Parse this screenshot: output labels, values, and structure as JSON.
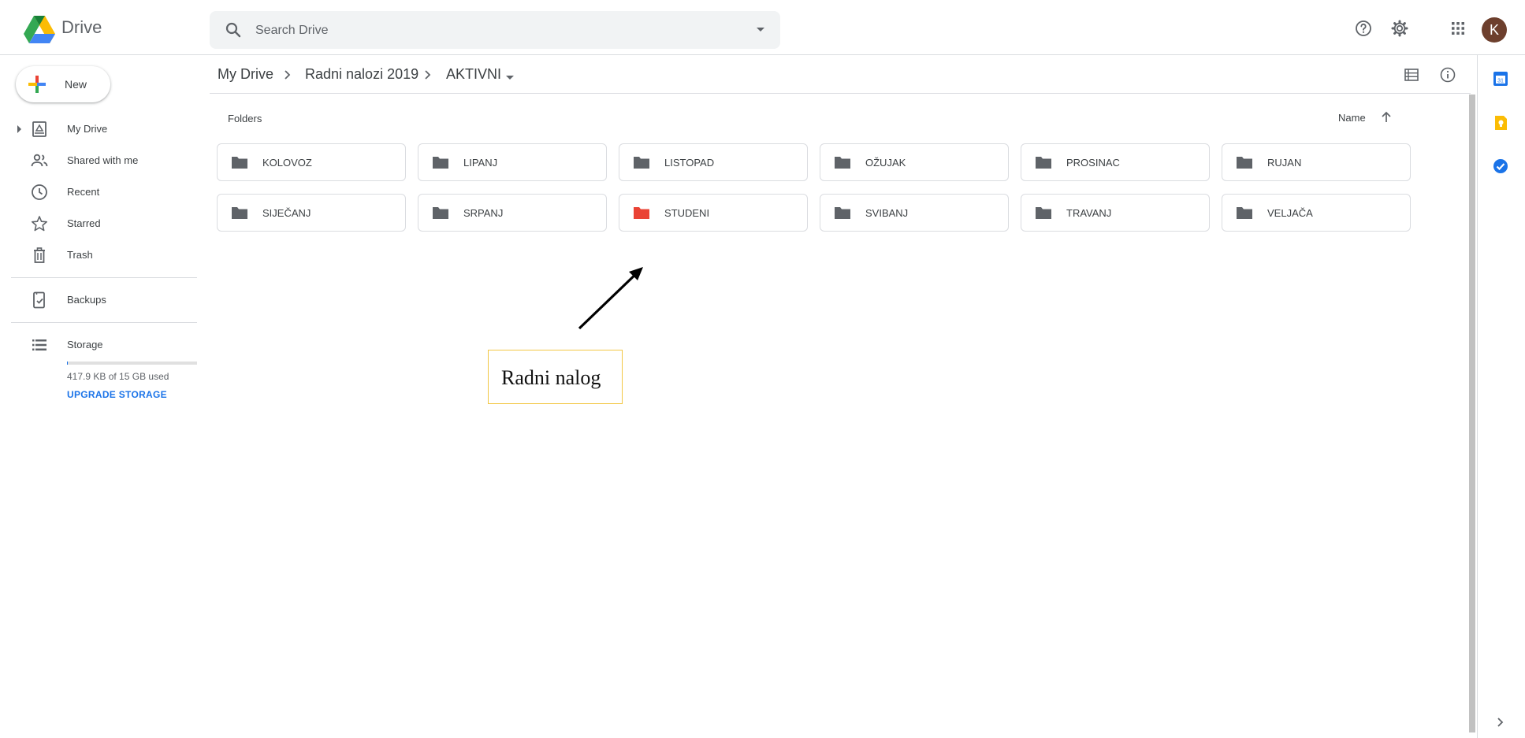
{
  "app": {
    "brand": "Drive",
    "avatar_initial": "K"
  },
  "search": {
    "placeholder": "Search Drive"
  },
  "sidebar": {
    "new_label": "New",
    "items": [
      {
        "label": "My Drive",
        "icon": "my-drive-icon"
      },
      {
        "label": "Shared with me",
        "icon": "people-icon"
      },
      {
        "label": "Recent",
        "icon": "clock-icon"
      },
      {
        "label": "Starred",
        "icon": "star-icon"
      },
      {
        "label": "Trash",
        "icon": "trash-icon"
      },
      {
        "label": "Backups",
        "icon": "backup-icon"
      },
      {
        "label": "Storage",
        "icon": "storage-icon"
      }
    ],
    "storage_used": "417.9 KB of 15 GB used",
    "storage_fraction": 3e-05,
    "upgrade_label": "UPGRADE STORAGE"
  },
  "breadcrumb": {
    "items": [
      "My Drive",
      "Radni nalozi 2019",
      "AKTIVNI"
    ]
  },
  "content": {
    "section_title": "Folders",
    "sort_label": "Name",
    "folders": [
      {
        "name": "KOLOVOZ",
        "color": "#5f6368"
      },
      {
        "name": "LIPANJ",
        "color": "#5f6368"
      },
      {
        "name": "LISTOPAD",
        "color": "#5f6368"
      },
      {
        "name": "OŽUJAK",
        "color": "#5f6368"
      },
      {
        "name": "PROSINAC",
        "color": "#5f6368"
      },
      {
        "name": "RUJAN",
        "color": "#5f6368"
      },
      {
        "name": "SIJEČANJ",
        "color": "#5f6368"
      },
      {
        "name": "SRPANJ",
        "color": "#5f6368"
      },
      {
        "name": "STUDENI",
        "color": "#ea4335"
      },
      {
        "name": "SVIBANJ",
        "color": "#5f6368"
      },
      {
        "name": "TRAVANJ",
        "color": "#5f6368"
      },
      {
        "name": "VELJAČA",
        "color": "#5f6368"
      }
    ]
  },
  "annotation": {
    "text": "Radni nalog"
  },
  "colors": {
    "accent": "#1a73e8",
    "highlight_folder": "#ea4335",
    "annotation_border": "#f2c744"
  }
}
